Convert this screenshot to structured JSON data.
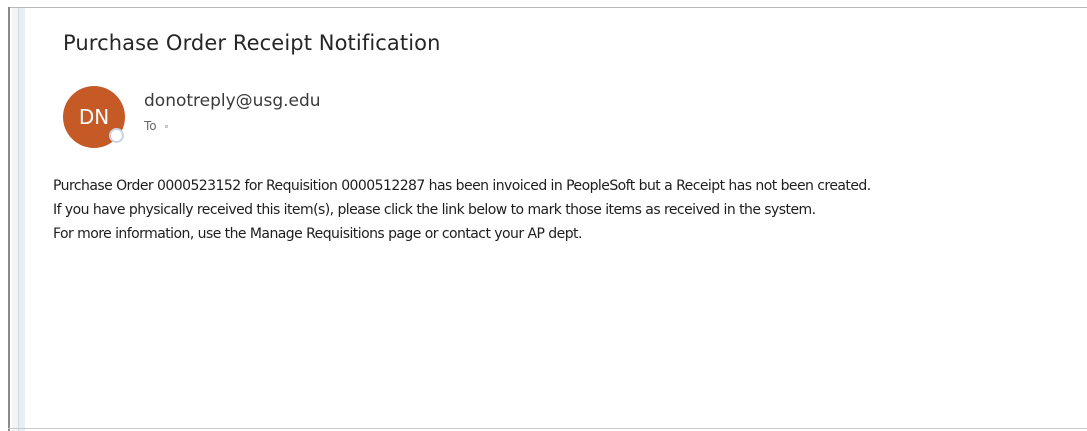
{
  "email": {
    "subject": "Purchase Order Receipt Notification",
    "avatar_initials": "DN",
    "avatar_color": "#c55a26",
    "sender": "donotreply@usg.edu",
    "to_label": "To",
    "body": {
      "line1": "Purchase Order 0000523152 for Requisition 0000512287 has been invoiced in PeopleSoft but a Receipt has not been created.",
      "line2": "If you have physically received this item(s), please click the link below to mark those items as received in the system.",
      "line3": "For more information, use the Manage Requisitions page or contact your AP dept."
    }
  }
}
